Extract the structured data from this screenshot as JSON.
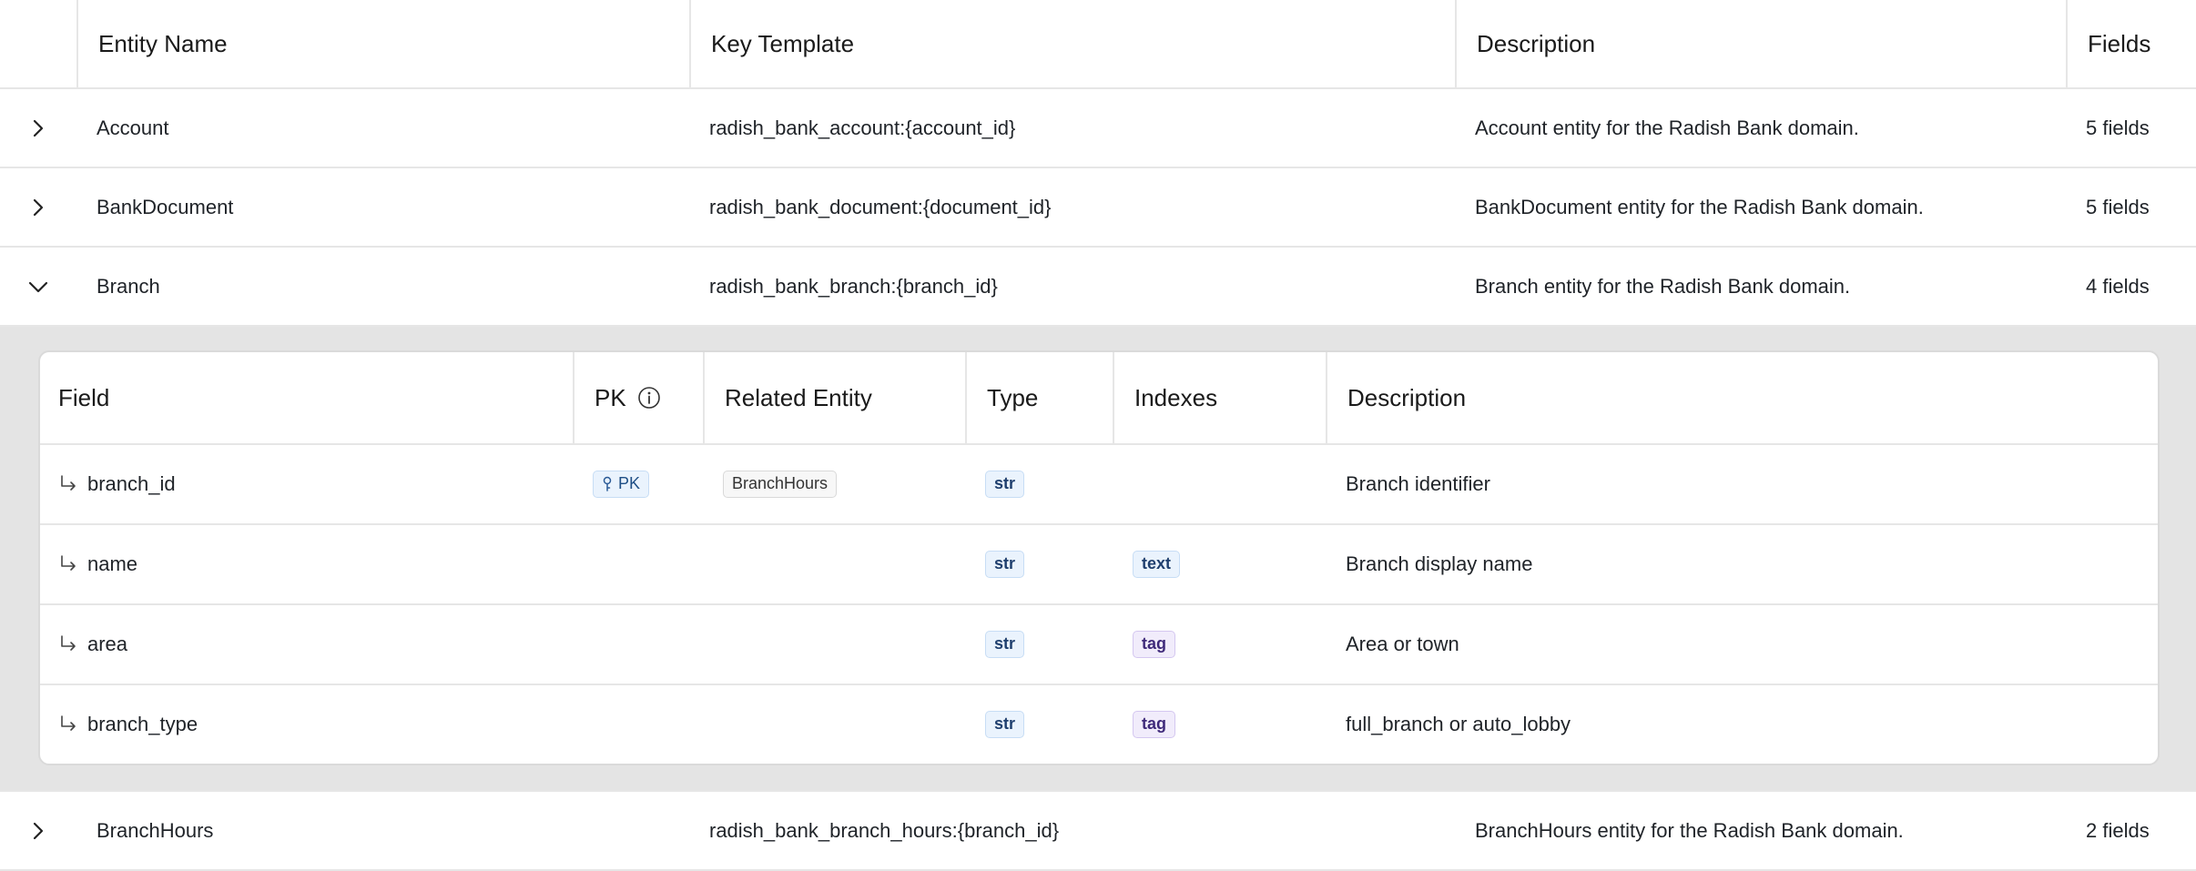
{
  "table": {
    "headers": {
      "entity_name": "Entity Name",
      "key_template": "Key Template",
      "description": "Description",
      "fields": "Fields"
    },
    "rows": [
      {
        "name": "Account",
        "key_template": "radish_bank_account:{account_id}",
        "description": "Account entity for the Radish Bank domain.",
        "fields": "5 fields",
        "expanded": false
      },
      {
        "name": "BankDocument",
        "key_template": "radish_bank_document:{document_id}",
        "description": "BankDocument entity for the Radish Bank domain.",
        "fields": "5 fields",
        "expanded": false
      },
      {
        "name": "Branch",
        "key_template": "radish_bank_branch:{branch_id}",
        "description": "Branch entity for the Radish Bank domain.",
        "fields": "4 fields",
        "expanded": true
      },
      {
        "name": "BranchHours",
        "key_template": "radish_bank_branch_hours:{branch_id}",
        "description": "BranchHours entity for the Radish Bank domain.",
        "fields": "2 fields",
        "expanded": false
      }
    ]
  },
  "subtable": {
    "headers": {
      "field": "Field",
      "pk": "PK",
      "related_entity": "Related Entity",
      "type": "Type",
      "indexes": "Indexes",
      "description": "Description"
    },
    "rows": [
      {
        "field": "branch_id",
        "pk": "PK",
        "related_entity": "BranchHours",
        "type": "str",
        "index": "",
        "description": "Branch identifier"
      },
      {
        "field": "name",
        "pk": "",
        "related_entity": "",
        "type": "str",
        "index": "text",
        "description": "Branch display name"
      },
      {
        "field": "area",
        "pk": "",
        "related_entity": "",
        "type": "str",
        "index": "tag",
        "description": "Area or town"
      },
      {
        "field": "branch_type",
        "pk": "",
        "related_entity": "",
        "type": "str",
        "index": "tag",
        "description": "full_branch or auto_lobby"
      }
    ]
  },
  "icons": {
    "collapsed": "chevron-right-icon",
    "expanded": "chevron-down-icon",
    "field_arrow": "subdirectory-arrow-icon",
    "pk_info": "info-icon",
    "pk_key": "key-icon"
  },
  "colors": {
    "expanded_background": "#e4e4e4",
    "type_badge": "#eaf3fd",
    "tag_badge": "#f1ecfb"
  }
}
